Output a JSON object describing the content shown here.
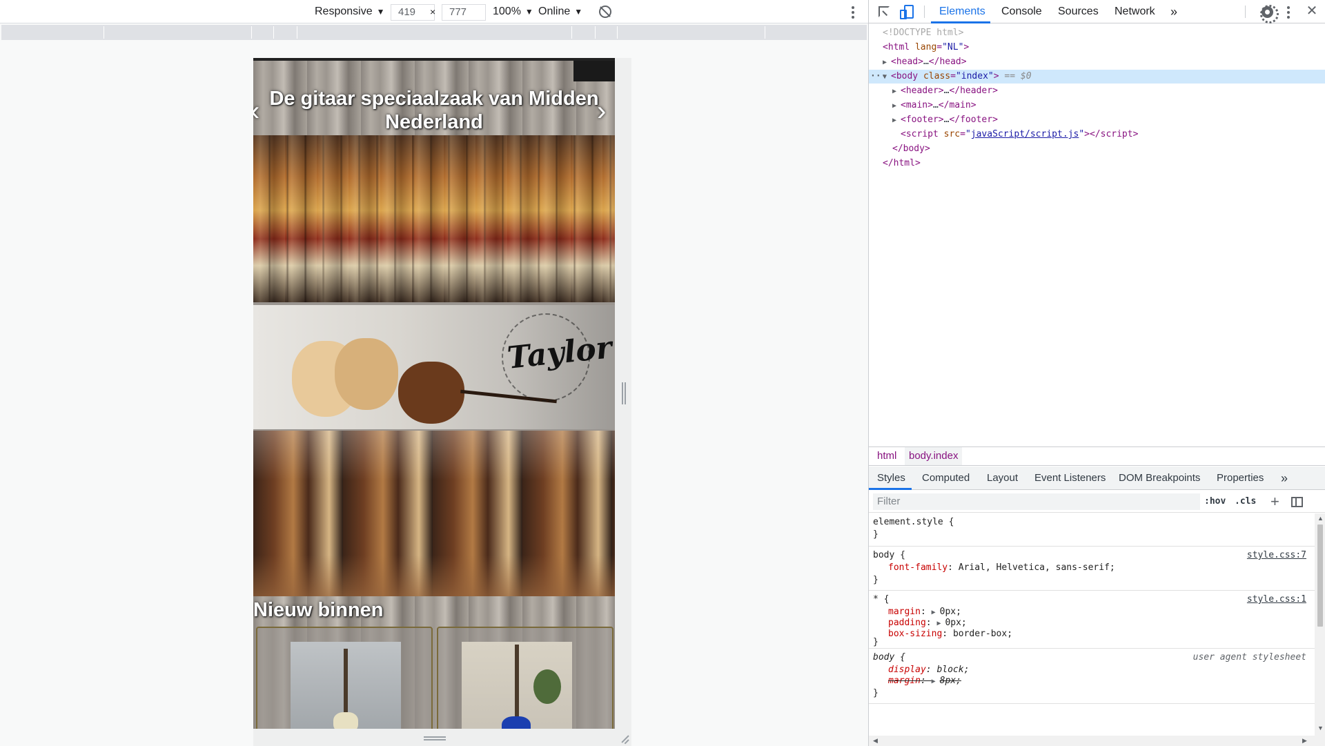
{
  "device_toolbar": {
    "device": "Responsive",
    "width": "419",
    "times": "×",
    "height": "777",
    "zoom": "100%",
    "throttling": "Online"
  },
  "website": {
    "hero_title": "De gitaar speciaalzaak van Midden Nederland",
    "prev_arrow": "‹",
    "next_arrow": "›",
    "taylor_logo": "Taylor",
    "new_section_title": "Nieuw binnen"
  },
  "devtools": {
    "tabs": [
      "Elements",
      "Console",
      "Sources",
      "Network"
    ],
    "more_tabs": "»",
    "close": "✕",
    "dom": {
      "doctype": "<!DOCTYPE html>",
      "html_open_tag": "html",
      "html_lang_attr": "lang",
      "html_lang_val": "\"NL\"",
      "head_tag": "head",
      "body_tag": "body",
      "body_class_attr": "class",
      "body_class_val": "\"index\"",
      "selected_suffix": " == $0",
      "header_tag": "header",
      "main_tag": "main",
      "footer_tag": "footer",
      "script_tag": "script",
      "script_src_attr": "src",
      "script_src_val": "javaScript/script.js",
      "body_close": "</body>",
      "html_close": "</html>",
      "ellipsis": "…"
    },
    "breadcrumb": [
      "html",
      "body.index"
    ],
    "subtabs": [
      "Styles",
      "Computed",
      "Layout",
      "Event Listeners",
      "DOM Breakpoints",
      "Properties"
    ],
    "filter_placeholder": "Filter",
    "hov": ":hov",
    "cls": ".cls",
    "plus": "+",
    "rules": {
      "element_style_selector": "element.style {",
      "close_brace": "}",
      "body1_selector": "body {",
      "body1_source": "style.css:7",
      "body1_prop": "font-family",
      "body1_val": "Arial, Helvetica, sans-serif;",
      "star_selector": "* {",
      "star_source": "style.css:1",
      "star_margin_prop": "margin",
      "star_margin_val": "0px;",
      "star_padding_prop": "padding",
      "star_padding_val": "0px;",
      "star_box_prop": "box-sizing",
      "star_box_val": "border-box;",
      "body2_selector": "body {",
      "body2_source": "user agent stylesheet",
      "body2_display_prop": "display",
      "body2_display_val": "block;",
      "body2_margin_prop": "margin",
      "body2_margin_val": "8px;"
    }
  }
}
